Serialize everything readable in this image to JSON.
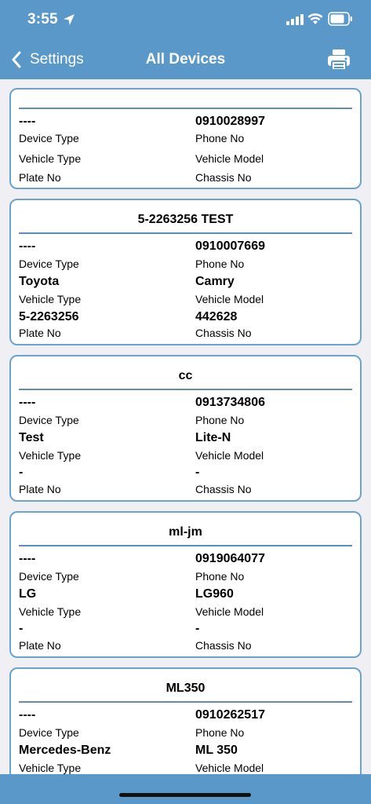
{
  "status_bar": {
    "time": "3:55"
  },
  "nav": {
    "back_label": "Settings",
    "title": "All Devices"
  },
  "labels": {
    "device_type": "Device Type",
    "phone_no": "Phone No",
    "vehicle_type": "Vehicle Type",
    "vehicle_model": "Vehicle Model",
    "plate_no": "Plate No",
    "chassis_no": "Chassis No"
  },
  "devices": [
    {
      "name": "",
      "device_type": "----",
      "phone_no": "0910028997",
      "vehicle_type": "",
      "vehicle_model": "",
      "plate_no": "",
      "chassis_no": ""
    },
    {
      "name": "5-2263256 TEST",
      "device_type": "----",
      "phone_no": "0910007669",
      "vehicle_type": "Toyota",
      "vehicle_model": "Camry",
      "plate_no": "5-2263256",
      "chassis_no": "442628"
    },
    {
      "name": "cc",
      "device_type": "----",
      "phone_no": "0913734806",
      "vehicle_type": "Test",
      "vehicle_model": "Lite-N",
      "plate_no": "-",
      "chassis_no": "-"
    },
    {
      "name": "ml-jm",
      "device_type": "----",
      "phone_no": "0919064077",
      "vehicle_type": "LG",
      "vehicle_model": "LG960",
      "plate_no": "-",
      "chassis_no": "-"
    },
    {
      "name": "ML350",
      "device_type": "----",
      "phone_no": "0910262517",
      "vehicle_type": "Mercedes-Benz",
      "vehicle_model": "ML 350",
      "plate_no": "",
      "chassis_no": ""
    }
  ]
}
